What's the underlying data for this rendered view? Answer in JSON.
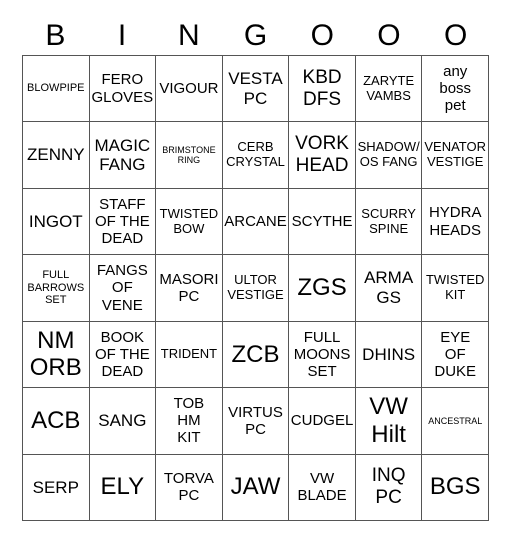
{
  "header": [
    "B",
    "I",
    "N",
    "G",
    "O",
    "O",
    "O"
  ],
  "cells": [
    {
      "text": "BLOWPIPE",
      "size": "s2"
    },
    {
      "text": "FERO\nGLOVES",
      "size": "s4"
    },
    {
      "text": "VIGOUR",
      "size": "s4"
    },
    {
      "text": "VESTA\nPC",
      "size": "s5"
    },
    {
      "text": "KBD\nDFS",
      "size": "s6"
    },
    {
      "text": "ZARYTE\nVAMBS",
      "size": "s3"
    },
    {
      "text": "any\nboss\npet",
      "size": "s4"
    },
    {
      "text": "ZENNY",
      "size": "s5"
    },
    {
      "text": "MAGIC\nFANG",
      "size": "s5"
    },
    {
      "text": "BRIMSTONE\nRING",
      "size": "s1"
    },
    {
      "text": "CERB\nCRYSTAL",
      "size": "s3"
    },
    {
      "text": "VORK\nHEAD",
      "size": "s6"
    },
    {
      "text": "SHADOW/\nOS FANG",
      "size": "s3"
    },
    {
      "text": "VENATOR\nVESTIGE",
      "size": "s3"
    },
    {
      "text": "INGOT",
      "size": "s5"
    },
    {
      "text": "STAFF\nOF THE\nDEAD",
      "size": "s4"
    },
    {
      "text": "TWISTED\nBOW",
      "size": "s3"
    },
    {
      "text": "ARCANE",
      "size": "s4"
    },
    {
      "text": "SCYTHE",
      "size": "s4"
    },
    {
      "text": "SCURRY\nSPINE",
      "size": "s3"
    },
    {
      "text": "HYDRA\nHEADS",
      "size": "s4"
    },
    {
      "text": "FULL\nBARROWS\nSET",
      "size": "s2"
    },
    {
      "text": "FANGS\nOF\nVENE",
      "size": "s4"
    },
    {
      "text": "MASORI\nPC",
      "size": "s4"
    },
    {
      "text": "ULTOR\nVESTIGE",
      "size": "s3"
    },
    {
      "text": "ZGS",
      "size": "s7"
    },
    {
      "text": "ARMA\nGS",
      "size": "s5"
    },
    {
      "text": "TWISTED\nKIT",
      "size": "s3"
    },
    {
      "text": "NM\nORB",
      "size": "s7"
    },
    {
      "text": "BOOK\nOF THE\nDEAD",
      "size": "s4"
    },
    {
      "text": "TRIDENT",
      "size": "s3"
    },
    {
      "text": "ZCB",
      "size": "s7"
    },
    {
      "text": "FULL\nMOONS\nSET",
      "size": "s4"
    },
    {
      "text": "DHINS",
      "size": "s5"
    },
    {
      "text": "EYE\nOF\nDUKE",
      "size": "s4"
    },
    {
      "text": "ACB",
      "size": "s7"
    },
    {
      "text": "SANG",
      "size": "s5"
    },
    {
      "text": "TOB\nHM\nKIT",
      "size": "s4"
    },
    {
      "text": "VIRTUS\nPC",
      "size": "s4"
    },
    {
      "text": "CUDGEL",
      "size": "s4"
    },
    {
      "text": "VW\nHilt",
      "size": "s7"
    },
    {
      "text": "ANCESTRAL",
      "size": "s1"
    },
    {
      "text": "SERP",
      "size": "s5"
    },
    {
      "text": "ELY",
      "size": "s7"
    },
    {
      "text": "TORVA\nPC",
      "size": "s4"
    },
    {
      "text": "JAW",
      "size": "s7"
    },
    {
      "text": "VW\nBLADE",
      "size": "s4"
    },
    {
      "text": "INQ\nPC",
      "size": "s6"
    },
    {
      "text": "BGS",
      "size": "s7"
    }
  ]
}
